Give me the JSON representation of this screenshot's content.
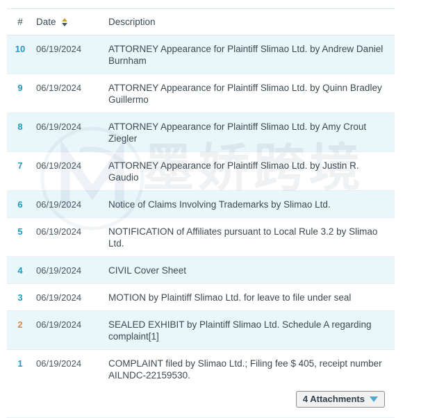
{
  "table": {
    "columns": {
      "number": "#",
      "date": "Date",
      "description": "Description",
      "sort_icon": "sort-ascending-descending-icon"
    },
    "rows": [
      {
        "number": "10",
        "date": "06/19/2024",
        "description": "ATTORNEY Appearance for Plaintiff Slimao Ltd. by Andrew Daniel Burnham"
      },
      {
        "number": "9",
        "date": "06/19/2024",
        "description": "ATTORNEY Appearance for Plaintiff Slimao Ltd. by Quinn Bradley Guillermo"
      },
      {
        "number": "8",
        "date": "06/19/2024",
        "description": "ATTORNEY Appearance for Plaintiff Slimao Ltd. by Amy Crout Ziegler"
      },
      {
        "number": "7",
        "date": "06/19/2024",
        "description": "ATTORNEY Appearance for Plaintiff Slimao Ltd. by Justin R. Gaudio"
      },
      {
        "number": "6",
        "date": "06/19/2024",
        "description": "Notice of Claims Involving Trademarks by Slimao Ltd."
      },
      {
        "number": "5",
        "date": "06/19/2024",
        "description": "NOTIFICATION of Affiliates pursuant to Local Rule 3.2 by Slimao Ltd."
      },
      {
        "number": "4",
        "date": "06/19/2024",
        "description": "CIVIL Cover Sheet"
      },
      {
        "number": "3",
        "date": "06/19/2024",
        "description": "MOTION by Plaintiff Slimao Ltd. for leave to file under seal"
      },
      {
        "number": "2",
        "date": "06/19/2024",
        "description": "SEALED EXHIBIT by Plaintiff Slimao Ltd. Schedule A regarding complaint[1]"
      },
      {
        "number": "1",
        "date": "06/19/2024",
        "description": "COMPLAINT filed by Slimao Ltd.; Filing fee $ 405, receipt number AILNDC-22159530."
      }
    ]
  },
  "attachments": {
    "label": "4 Attachments",
    "caret_icon": "caret-down-icon"
  },
  "watermark": {
    "text": "墨娇跨境",
    "logo_icon": "brand-m-logo-icon"
  },
  "colors": {
    "row_number": "#1f9ac4",
    "row_number_highlight": "#d98843",
    "row_alt_background": "#e9f6fa",
    "caret": "#4fa8cf"
  }
}
